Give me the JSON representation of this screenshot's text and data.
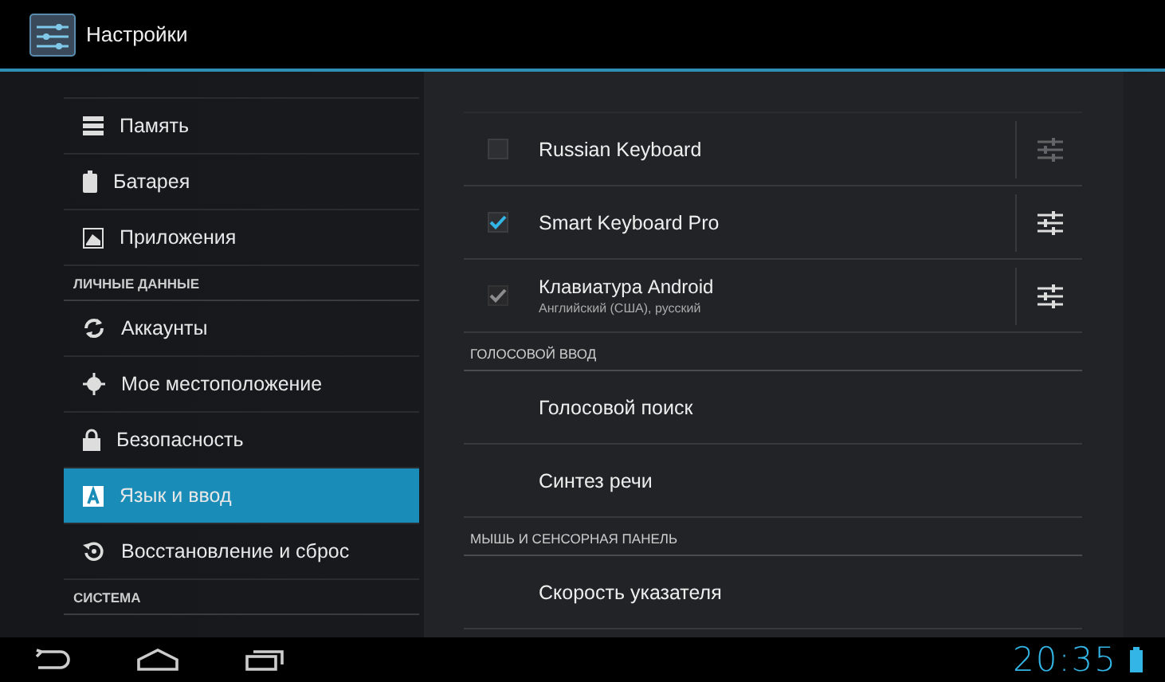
{
  "action_bar": {
    "title": "Настройки"
  },
  "sidebar": {
    "items": [
      {
        "kind": "item",
        "label": "Память",
        "selected": false
      },
      {
        "kind": "item",
        "label": "Батарея",
        "selected": false
      },
      {
        "kind": "item",
        "label": "Приложения",
        "selected": false
      },
      {
        "kind": "header",
        "label": "ЛИЧНЫЕ ДАННЫЕ"
      },
      {
        "kind": "item",
        "label": "Аккаунты",
        "selected": false
      },
      {
        "kind": "item",
        "label": "Мое местоположение",
        "selected": false
      },
      {
        "kind": "item",
        "label": "Безопасность",
        "selected": false
      },
      {
        "kind": "item",
        "label": "Язык и ввод",
        "selected": true
      },
      {
        "kind": "item",
        "label": "Восстановление и сброс",
        "selected": false
      },
      {
        "kind": "header",
        "label": "СИСТЕМА"
      }
    ]
  },
  "detail": {
    "items": [
      {
        "kind": "input_method",
        "title": "Russian Keyboard",
        "checked": false,
        "disabled": false
      },
      {
        "kind": "input_method",
        "title": "Smart Keyboard Pro",
        "checked": true,
        "disabled": false
      },
      {
        "kind": "input_method",
        "title": "Клавиатура Android",
        "subtitle": "Английский (США), русский",
        "checked": true,
        "disabled": true
      },
      {
        "kind": "header",
        "title": "ГОЛОСОВОЙ ВВОД"
      },
      {
        "kind": "setting",
        "title": "Голосовой поиск"
      },
      {
        "kind": "setting",
        "title": "Синтез речи"
      },
      {
        "kind": "header",
        "title": "МЫШЬ И СЕНСОРНАЯ ПАНЕЛЬ"
      },
      {
        "kind": "setting",
        "title": "Скорость указателя"
      }
    ]
  },
  "nav_bar": {
    "time": "20:35"
  }
}
